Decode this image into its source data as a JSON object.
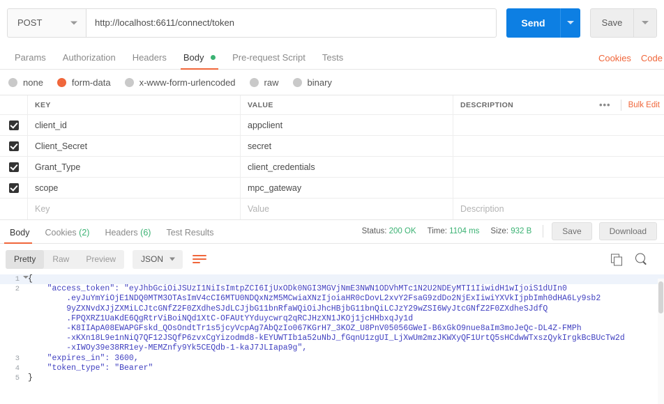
{
  "request": {
    "method": "POST",
    "url": "http://localhost:6611/connect/token",
    "send_label": "Send",
    "save_label": "Save",
    "tabs": [
      {
        "label": "Params",
        "active": false
      },
      {
        "label": "Authorization",
        "active": false
      },
      {
        "label": "Headers",
        "active": false
      },
      {
        "label": "Body",
        "active": true,
        "dot": true
      },
      {
        "label": "Pre-request Script",
        "active": false
      },
      {
        "label": "Tests",
        "active": false
      }
    ],
    "links": [
      {
        "label": "Cookies"
      },
      {
        "label": "Code"
      }
    ],
    "body_types": [
      {
        "label": "none",
        "selected": false
      },
      {
        "label": "form-data",
        "selected": true
      },
      {
        "label": "x-www-form-urlencoded",
        "selected": false
      },
      {
        "label": "raw",
        "selected": false
      },
      {
        "label": "binary",
        "selected": false
      }
    ]
  },
  "kv_table": {
    "headers": {
      "key": "KEY",
      "value": "VALUE",
      "description": "DESCRIPTION"
    },
    "bulk_edit_label": "Bulk Edit",
    "dots_label": "•••",
    "rows": [
      {
        "checked": true,
        "key": "client_id",
        "value": "appclient",
        "description": ""
      },
      {
        "checked": true,
        "key": "Client_Secret",
        "value": "secret",
        "description": ""
      },
      {
        "checked": true,
        "key": "Grant_Type",
        "value": "client_credentials",
        "description": ""
      },
      {
        "checked": true,
        "key": "scope",
        "value": "mpc_gateway",
        "description": ""
      }
    ],
    "placeholder_row": {
      "key": "Key",
      "value": "Value",
      "description": "Description"
    }
  },
  "response": {
    "tabs": [
      {
        "label": "Body",
        "count": "",
        "active": true
      },
      {
        "label": "Cookies",
        "count": "(2)",
        "active": false
      },
      {
        "label": "Headers",
        "count": "(6)",
        "active": false
      },
      {
        "label": "Test Results",
        "count": "",
        "active": false
      }
    ],
    "meta": {
      "status_label": "Status:",
      "status_value": "200 OK",
      "time_label": "Time:",
      "time_value": "1104 ms",
      "size_label": "Size:",
      "size_value": "932 B"
    },
    "save_label": "Save",
    "download_label": "Download",
    "view_modes": [
      {
        "label": "Pretty",
        "active": true
      },
      {
        "label": "Raw",
        "active": false
      },
      {
        "label": "Preview",
        "active": false
      }
    ],
    "format": "JSON",
    "code_lines": [
      {
        "no": "1",
        "fold": true,
        "text": "{",
        "highlight": true
      },
      {
        "no": "2",
        "fold": false,
        "text": "    \"access_token\": \"eyJhbGciOiJSUzI1NiIsImtpZCI6IjUxODk0NGI3MGVjNmE3NWN1ODVhMTc1N2U2NDEyMTI1IiwidH1wIjoiS1dUIn0",
        "highlight": false
      },
      {
        "no": "",
        "fold": false,
        "text": "        .eyJuYmYiOjE1NDQ0MTM3OTAsImV4cCI6MTU0NDQxNzM5MCwiaXNzIjoiaHR0cDovL2xvY2FsaG9zdDo2NjExIiwiYXVkIjpbImh0dHA6Ly9sb2",
        "highlight": false
      },
      {
        "no": "",
        "fold": false,
        "text": "        9yZXNvdXJjZXMiLCJtcGNfZ2F0ZXdheSJdLCJjbG11bnRfaWQiOiJhcHBjbG11bnQiLCJzY29wZSI6WyJtcGNfZ2F0ZXdheSJdfQ",
        "highlight": false
      },
      {
        "no": "",
        "fold": false,
        "text": "        .FPQXRZ1UaKdE6QgRtrViBoiNQd1XtC-OFAUtYYduycwrq2qRCJHzXN1JKOj1jcHHbxqJy1d",
        "highlight": false
      },
      {
        "no": "",
        "fold": false,
        "text": "        -K8IIApA08EWAPGFskd_QOsOndtTr1s5jcyVcpAg7AbQzIo067KGrH7_3KOZ_U8PnV05056GWeI-B6xGkO9nue8aIm3moJeQc-DL4Z-FMPh",
        "highlight": false
      },
      {
        "no": "",
        "fold": false,
        "text": "        -xKXn18L9e1nNiQ7QF12JSQfP6zvxCgYizodmd8-kEYUWTIb1a52uNbJ_fGqnU1zgUI_LjXwUm2mzJKWXyQF1UrtQ5sHCdwWTxszQykIrgkBcBUcTw2d",
        "highlight": false
      },
      {
        "no": "",
        "fold": false,
        "text": "        -xIWOy39e38RR1ey-MEMZnfy9Yk5CEQdb-1-kaJ7JLIapa9g\",",
        "highlight": false
      },
      {
        "no": "3",
        "fold": false,
        "text": "    \"expires_in\": 3600,",
        "highlight": false
      },
      {
        "no": "4",
        "fold": false,
        "text": "    \"token_type\": \"Bearer\"",
        "highlight": false
      },
      {
        "no": "5",
        "fold": false,
        "text": "}",
        "highlight": false
      }
    ]
  },
  "colors": {
    "accent_orange": "#f0663a",
    "send_blue": "#0d7fe3",
    "status_green": "#3bb273",
    "code_blue": "#4040c0"
  }
}
